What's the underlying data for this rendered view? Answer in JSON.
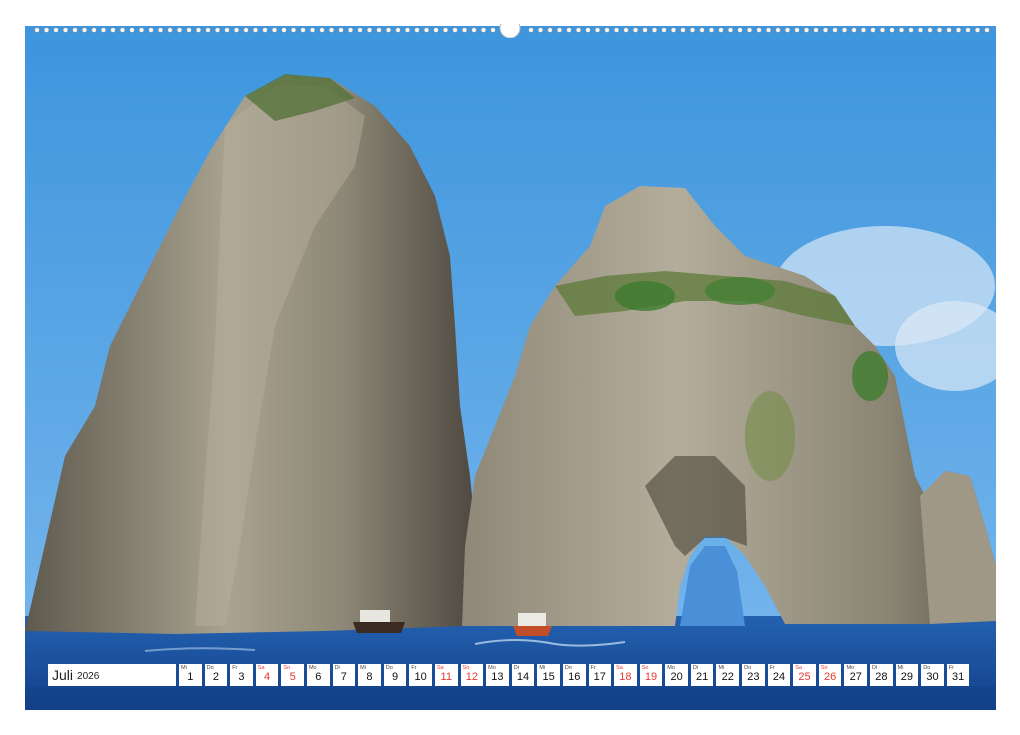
{
  "calendar": {
    "month": "Juli",
    "year": "2026",
    "weekend_color": "#e53935",
    "days": [
      {
        "dow": "Mi",
        "num": "1",
        "weekend": false
      },
      {
        "dow": "Do",
        "num": "2",
        "weekend": false
      },
      {
        "dow": "Fr",
        "num": "3",
        "weekend": false
      },
      {
        "dow": "Sa",
        "num": "4",
        "weekend": true
      },
      {
        "dow": "So",
        "num": "5",
        "weekend": true
      },
      {
        "dow": "Mo",
        "num": "6",
        "weekend": false
      },
      {
        "dow": "Di",
        "num": "7",
        "weekend": false
      },
      {
        "dow": "Mi",
        "num": "8",
        "weekend": false
      },
      {
        "dow": "Do",
        "num": "9",
        "weekend": false
      },
      {
        "dow": "Fr",
        "num": "10",
        "weekend": false
      },
      {
        "dow": "Sa",
        "num": "11",
        "weekend": true
      },
      {
        "dow": "So",
        "num": "12",
        "weekend": true
      },
      {
        "dow": "Mo",
        "num": "13",
        "weekend": false
      },
      {
        "dow": "Di",
        "num": "14",
        "weekend": false
      },
      {
        "dow": "Mi",
        "num": "15",
        "weekend": false
      },
      {
        "dow": "Do",
        "num": "16",
        "weekend": false
      },
      {
        "dow": "Fr",
        "num": "17",
        "weekend": false
      },
      {
        "dow": "Sa",
        "num": "18",
        "weekend": true
      },
      {
        "dow": "So",
        "num": "19",
        "weekend": true
      },
      {
        "dow": "Mo",
        "num": "20",
        "weekend": false
      },
      {
        "dow": "Di",
        "num": "21",
        "weekend": false
      },
      {
        "dow": "Mi",
        "num": "22",
        "weekend": false
      },
      {
        "dow": "Do",
        "num": "23",
        "weekend": false
      },
      {
        "dow": "Fr",
        "num": "24",
        "weekend": false
      },
      {
        "dow": "Sa",
        "num": "25",
        "weekend": true
      },
      {
        "dow": "So",
        "num": "26",
        "weekend": true
      },
      {
        "dow": "Mo",
        "num": "27",
        "weekend": false
      },
      {
        "dow": "Di",
        "num": "28",
        "weekend": false
      },
      {
        "dow": "Mi",
        "num": "29",
        "weekend": false
      },
      {
        "dow": "Do",
        "num": "30",
        "weekend": false
      },
      {
        "dow": "Fr",
        "num": "31",
        "weekend": false
      }
    ]
  },
  "photo": {
    "subject": "sea-stacks-with-boats",
    "sky_color": "#4a9fe0",
    "sea_color": "#1a4f9a",
    "rock_color": "#a29a86"
  }
}
